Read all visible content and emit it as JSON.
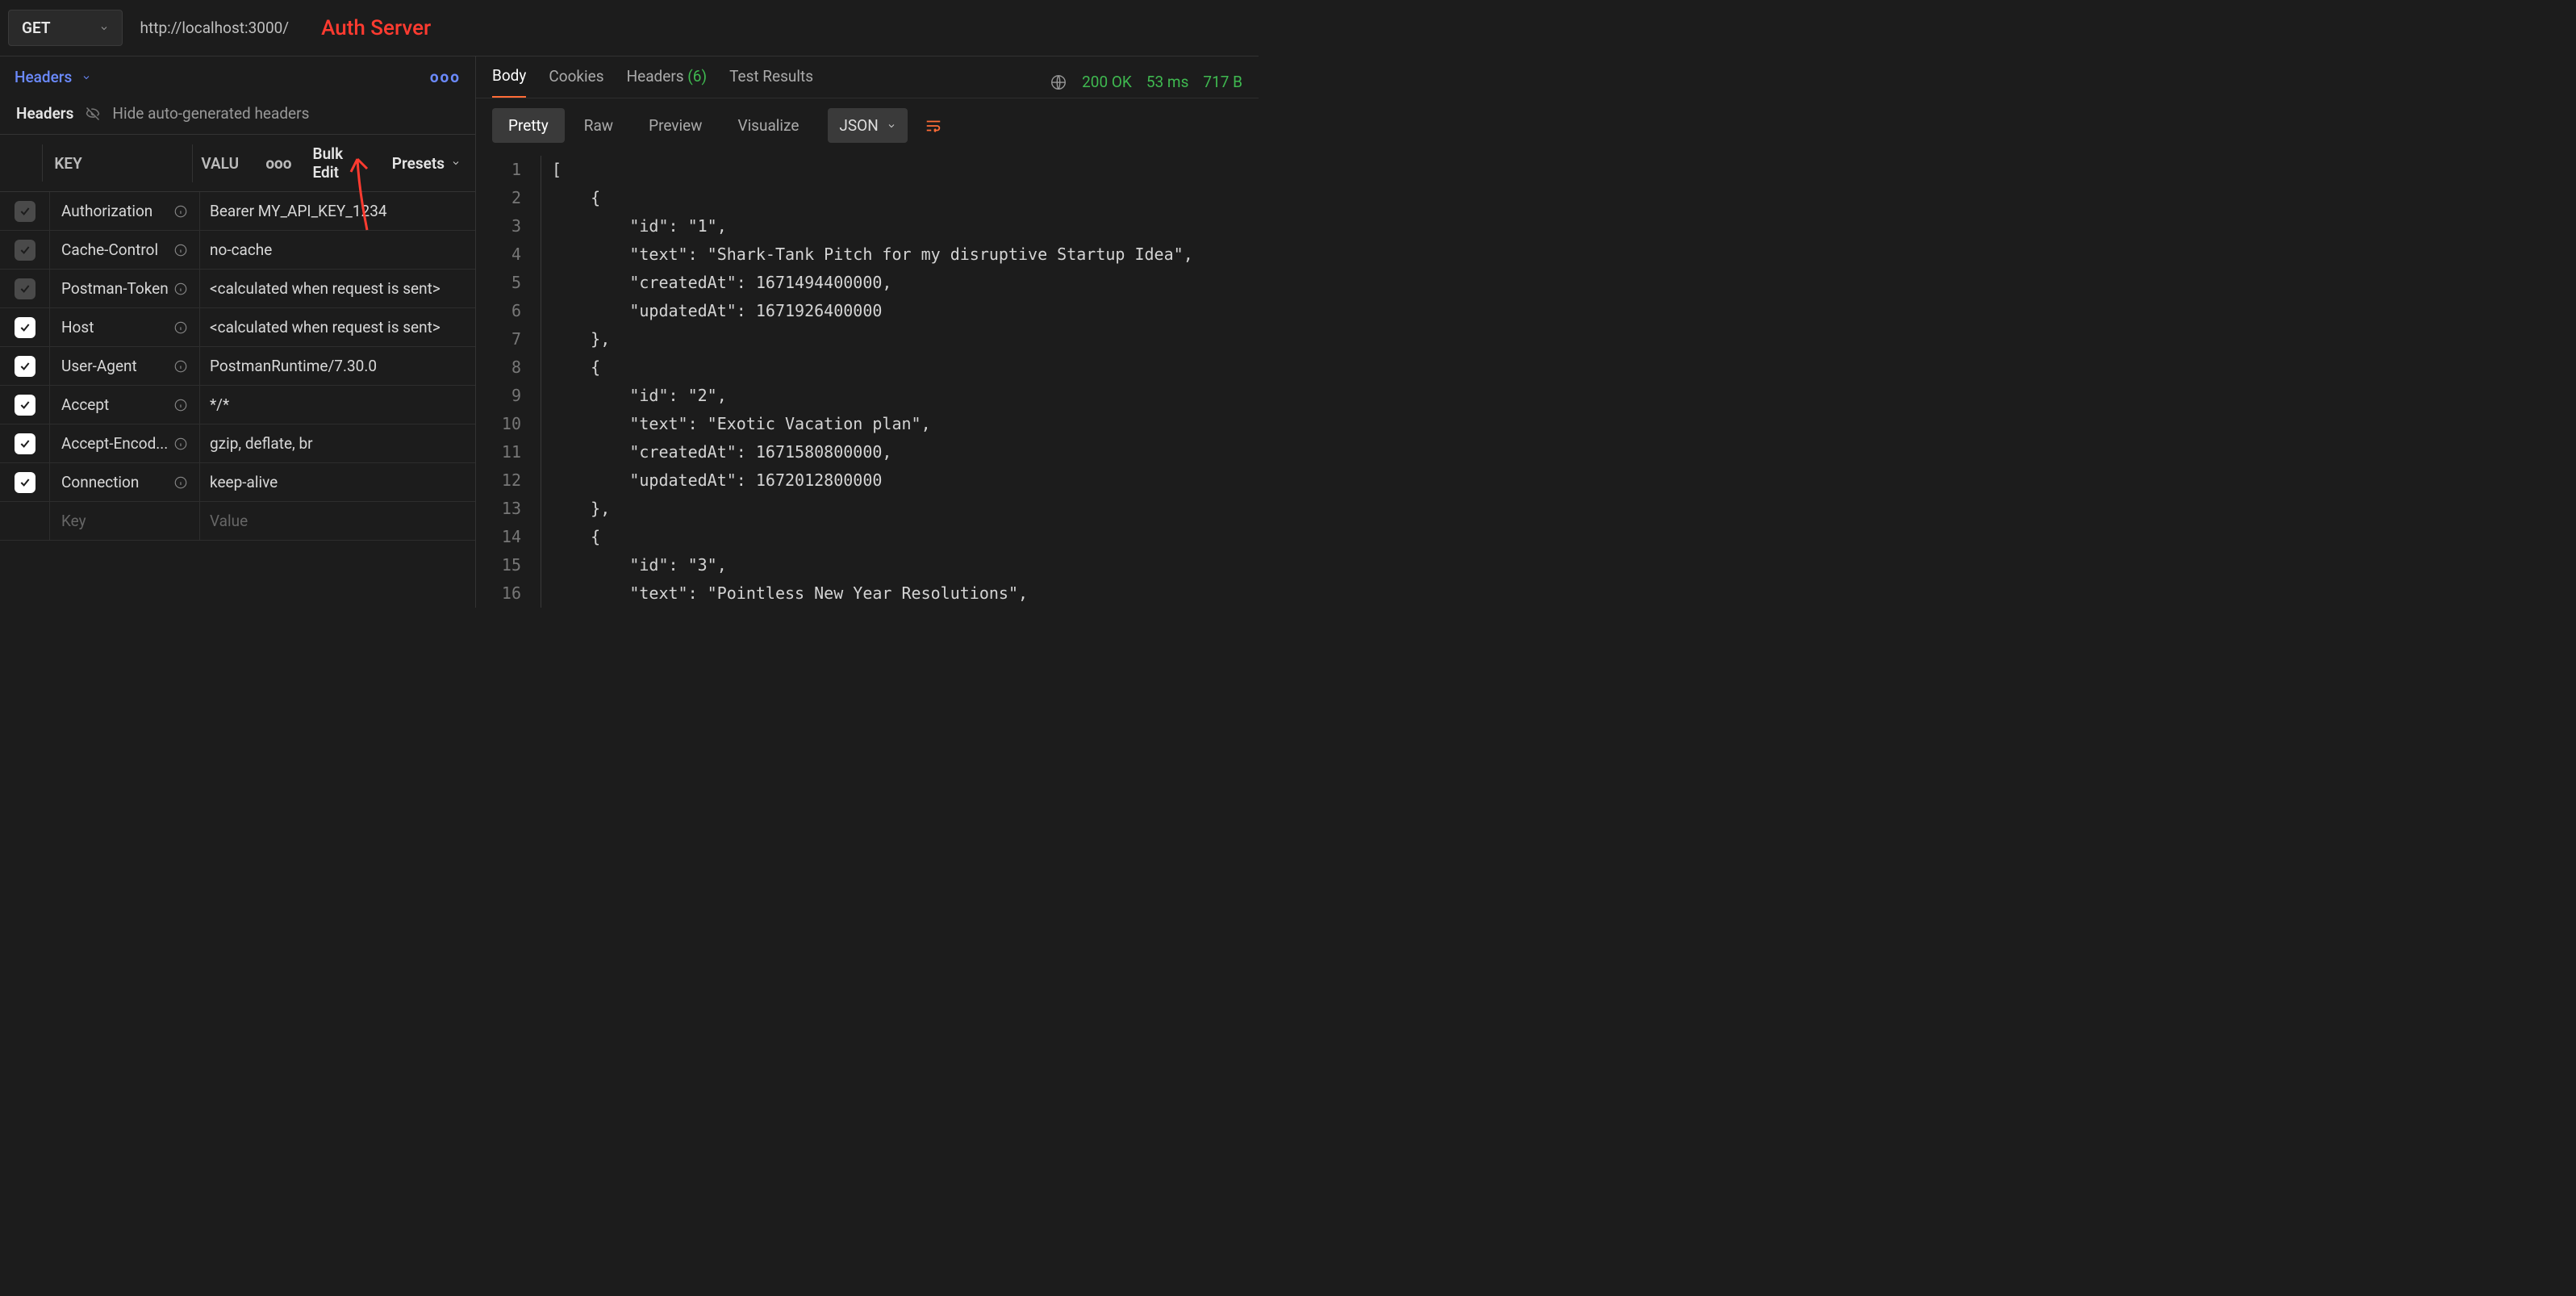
{
  "request": {
    "method": "GET",
    "url": "http://localhost:3000/",
    "annotation": "Auth Server"
  },
  "left_tab_label": "Headers",
  "hide_autogen_title": "Headers",
  "hide_autogen_label": "Hide auto-generated headers",
  "table_header": {
    "key": "KEY",
    "value": "VALU",
    "more": "ooo",
    "bulk_edit": "Bulk Edit",
    "presets": "Presets"
  },
  "headers": [
    {
      "checked": true,
      "dim": true,
      "key": "Authorization",
      "info": true,
      "value": "Bearer MY_API_KEY_1234"
    },
    {
      "checked": true,
      "dim": true,
      "key": "Cache-Control",
      "info": true,
      "value": "no-cache"
    },
    {
      "checked": true,
      "dim": true,
      "key": "Postman-Token",
      "info": true,
      "value": "<calculated when request is sent>"
    },
    {
      "checked": true,
      "dim": false,
      "key": "Host",
      "info": true,
      "value": "<calculated when request is sent>"
    },
    {
      "checked": true,
      "dim": false,
      "key": "User-Agent",
      "info": true,
      "value": "PostmanRuntime/7.30.0"
    },
    {
      "checked": true,
      "dim": false,
      "key": "Accept",
      "info": true,
      "value": "*/*"
    },
    {
      "checked": true,
      "dim": false,
      "key": "Accept-Encod...",
      "info": true,
      "value": "gzip, deflate, br"
    },
    {
      "checked": true,
      "dim": false,
      "key": "Connection",
      "info": true,
      "value": "keep-alive"
    }
  ],
  "blank_row": {
    "key": "Key",
    "value": "Value"
  },
  "response_tabs": {
    "body": "Body",
    "cookies": "Cookies",
    "headers": "Headers",
    "headers_count": "(6)",
    "test_results": "Test Results"
  },
  "status": {
    "code": "200 OK",
    "time": "53 ms",
    "size": "717 B"
  },
  "format_tabs": {
    "pretty": "Pretty",
    "raw": "Raw",
    "preview": "Preview",
    "visualize": "Visualize",
    "lang": "JSON"
  },
  "code_lines": [
    {
      "n": 1,
      "html": "<span class='hl tok-punc'>[</span>"
    },
    {
      "n": 2,
      "html": "    <span class='tok-punc'>{</span>"
    },
    {
      "n": 3,
      "html": "        <span class='tok-key'>\"id\"</span><span class='tok-punc'>: </span><span class='tok-str'>\"1\"</span><span class='tok-punc'>,</span>"
    },
    {
      "n": 4,
      "html": "        <span class='tok-key'>\"text\"</span><span class='tok-punc'>: </span><span class='tok-str'>\"Shark-Tank Pitch for my disruptive Startup Idea\"</span><span class='tok-punc'>,</span>"
    },
    {
      "n": 5,
      "html": "        <span class='tok-key'>\"createdAt\"</span><span class='tok-punc'>: </span><span class='tok-num'>1671494400000</span><span class='tok-punc'>,</span>"
    },
    {
      "n": 6,
      "html": "        <span class='tok-key'>\"updatedAt\"</span><span class='tok-punc'>: </span><span class='tok-num'>1671926400000</span>"
    },
    {
      "n": 7,
      "html": "    <span class='tok-punc'>},</span>"
    },
    {
      "n": 8,
      "html": "    <span class='tok-punc'>{</span>"
    },
    {
      "n": 9,
      "html": "        <span class='tok-key'>\"id\"</span><span class='tok-punc'>: </span><span class='tok-str'>\"2\"</span><span class='tok-punc'>,</span>"
    },
    {
      "n": 10,
      "html": "        <span class='tok-key'>\"text\"</span><span class='tok-punc'>: </span><span class='tok-str'>\"Exotic Vacation plan\"</span><span class='tok-punc'>,</span>"
    },
    {
      "n": 11,
      "html": "        <span class='tok-key'>\"createdAt\"</span><span class='tok-punc'>: </span><span class='tok-num'>1671580800000</span><span class='tok-punc'>,</span>"
    },
    {
      "n": 12,
      "html": "        <span class='tok-key'>\"updatedAt\"</span><span class='tok-punc'>: </span><span class='tok-num'>1672012800000</span>"
    },
    {
      "n": 13,
      "html": "    <span class='tok-punc'>},</span>"
    },
    {
      "n": 14,
      "html": "    <span class='tok-punc'>{</span>"
    },
    {
      "n": 15,
      "html": "        <span class='tok-key'>\"id\"</span><span class='tok-punc'>: </span><span class='tok-str'>\"3\"</span><span class='tok-punc'>,</span>"
    },
    {
      "n": 16,
      "html": "        <span class='tok-key'>\"text\"</span><span class='tok-punc'>: </span><span class='tok-str'>\"Pointless New Year Resolutions\"</span><span class='tok-punc'>,</span>"
    }
  ]
}
